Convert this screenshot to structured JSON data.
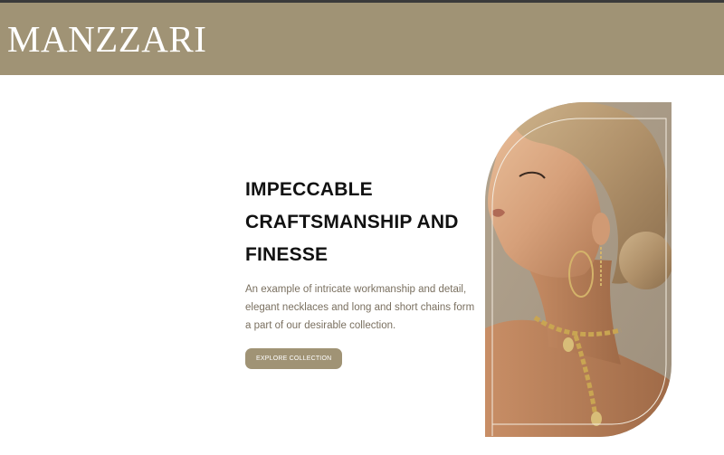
{
  "header": {
    "brand": "MANZZARI",
    "brand_color": "#a09375"
  },
  "hero": {
    "heading": "IMPECCABLE CRAFTSMANSHIP AND FINESSE",
    "description": "An example of intricate workmanship and detail, elegant necklaces and long and short chains form a part of our desirable collection.",
    "cta_label": "EXPLORE COLLECTION"
  },
  "colors": {
    "accent": "#a09375",
    "heading": "#111111",
    "body_text": "#7a7060"
  }
}
